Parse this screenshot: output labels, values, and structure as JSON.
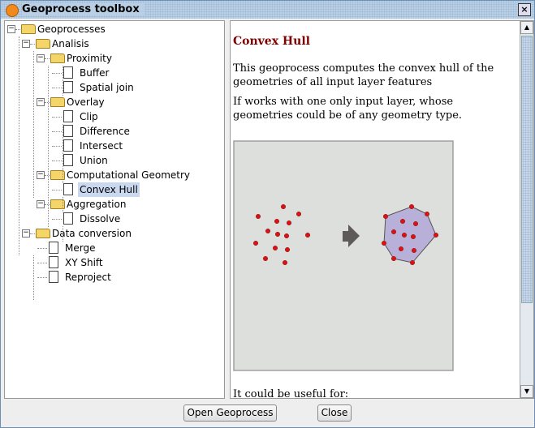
{
  "window": {
    "title": "Geoprocess toolbox"
  },
  "tree": [
    {
      "label": "Geoprocesses",
      "level": 0,
      "type": "folder"
    },
    {
      "label": "Analisis",
      "level": 1,
      "type": "folder"
    },
    {
      "label": "Proximity",
      "level": 2,
      "type": "folder"
    },
    {
      "label": "Buffer",
      "level": 3,
      "type": "leaf"
    },
    {
      "label": "Spatial join",
      "level": 3,
      "type": "leaf"
    },
    {
      "label": "Overlay",
      "level": 2,
      "type": "folder"
    },
    {
      "label": "Clip",
      "level": 3,
      "type": "leaf"
    },
    {
      "label": "Difference",
      "level": 3,
      "type": "leaf"
    },
    {
      "label": "Intersect",
      "level": 3,
      "type": "leaf"
    },
    {
      "label": "Union",
      "level": 3,
      "type": "leaf"
    },
    {
      "label": "Computational Geometry",
      "level": 2,
      "type": "folder"
    },
    {
      "label": "Convex Hull",
      "level": 3,
      "type": "leaf",
      "selected": true
    },
    {
      "label": "Aggregation",
      "level": 2,
      "type": "folder"
    },
    {
      "label": "Dissolve",
      "level": 3,
      "type": "leaf"
    },
    {
      "label": "Data conversion",
      "level": 1,
      "type": "folder"
    },
    {
      "label": "Merge",
      "level": 2,
      "type": "leaf"
    },
    {
      "label": "XY Shift",
      "level": 2,
      "type": "leaf"
    },
    {
      "label": "Reproject",
      "level": 2,
      "type": "leaf"
    }
  ],
  "doc": {
    "heading": "Convex Hull",
    "p1": "This geoprocess computes the convex hull of the geometries of all input layer features",
    "p2": "If works with one only input layer, whose geometries could be of any geometry type.",
    "p3": "It could be useful for:"
  },
  "buttons": {
    "open": "Open Geoprocess",
    "close": "Close"
  },
  "colors": {
    "heading": "#800000",
    "point": "#dd1111",
    "hull": "#b8b0d8",
    "selection": "#c9d8ee"
  }
}
